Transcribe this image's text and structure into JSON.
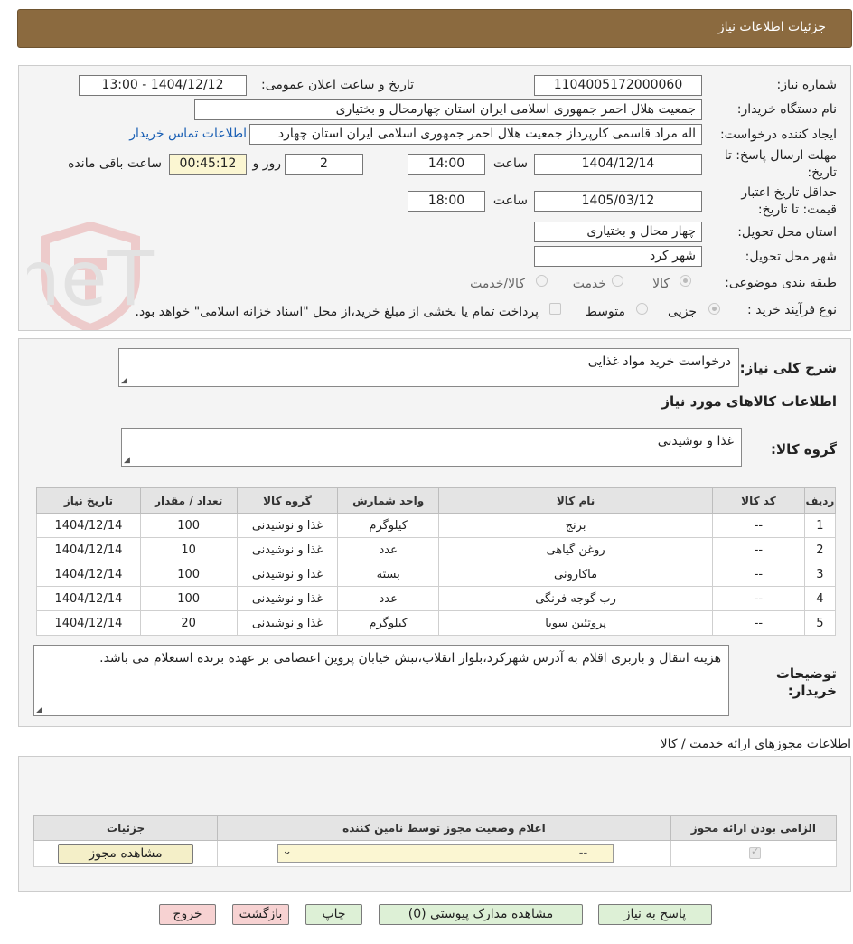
{
  "header": {
    "title": "جزئیات اطلاعات نیاز"
  },
  "watermark": {
    "text": "AriaTender.neT"
  },
  "form": {
    "need_number_label": "شماره نیاز:",
    "need_number": "1104005172000060",
    "announce_label": "تاریخ و ساعت اعلان عمومی:",
    "announce_value": "1404/12/12 - 13:00",
    "buyer_org_label": "نام دستگاه خریدار:",
    "buyer_org": "جمعیت هلال احمر جمهوری اسلامی ایران استان چهارمحال و بختیاری",
    "requester_label": "ایجاد کننده درخواست:",
    "requester": "اله مراد قاسمی کارپرداز جمعیت هلال احمر جمهوری اسلامی ایران استان چهارد",
    "contact_link": "اطلاعات تماس خریدار",
    "deadline_label_1": "مهلت ارسال پاسخ: تا",
    "deadline_label_2": "تاریخ:",
    "deadline_date": "1404/12/14",
    "time_label": "ساعت",
    "deadline_time": "14:00",
    "days_value": "2",
    "days_label": "روز و",
    "remaining_time": "00:45:12",
    "remaining_label": "ساعت باقی مانده",
    "validity_label_1": "حداقل تاریخ اعتبار",
    "validity_label_2": "قیمت: تا تاریخ:",
    "validity_date": "1405/03/12",
    "validity_time_label": "ساعت",
    "validity_time": "18:00",
    "province_label": "استان محل تحویل:",
    "province": "چهار محال و بختیاری",
    "city_label": "شهر محل تحویل:",
    "city": "شهر کرد",
    "category_label": "طبقه بندی موضوعی:",
    "category_options": [
      "کالا",
      "خدمت",
      "کالا/خدمت"
    ],
    "category_selected": "کالا",
    "process_label": "نوع فرآیند خرید :",
    "process_options": [
      "جزیی",
      "متوسط"
    ],
    "process_selected": "جزیی",
    "payment_note": "پرداخت تمام یا بخشی از مبلغ خرید،از محل \"اسناد خزانه اسلامی\" خواهد بود."
  },
  "summary": {
    "general_desc_label": "شرح کلی نیاز:",
    "general_desc": "درخواست خرید مواد غذایی",
    "goods_info_title": "اطلاعات کالاهای مورد نیاز",
    "goods_group_label": "گروه کالا:",
    "goods_group": "غذا و نوشیدنی"
  },
  "goods_table": {
    "headers": [
      "ردیف",
      "کد کالا",
      "نام کالا",
      "واحد شمارش",
      "گروه کالا",
      "تعداد / مقدار",
      "تاریخ نیاز"
    ],
    "rows": [
      [
        "1",
        "--",
        "برنج",
        "کیلوگرم",
        "غذا و نوشیدنی",
        "100",
        "1404/12/14"
      ],
      [
        "2",
        "--",
        "روغن گیاهی",
        "عدد",
        "غذا و نوشیدنی",
        "10",
        "1404/12/14"
      ],
      [
        "3",
        "--",
        "ماکارونی",
        "بسته",
        "غذا و نوشیدنی",
        "100",
        "1404/12/14"
      ],
      [
        "4",
        "--",
        "رب گوجه فرنگی",
        "عدد",
        "غذا و نوشیدنی",
        "100",
        "1404/12/14"
      ],
      [
        "5",
        "--",
        "پروتئین سویا",
        "کیلوگرم",
        "غذا و نوشیدنی",
        "20",
        "1404/12/14"
      ]
    ]
  },
  "buyer_notes": {
    "label_1": "توضیحات",
    "label_2": "خریدار:",
    "text": "هزینه انتقال و باربری اقلام به آدرس شهرکرد،بلوار انقلاب،نبش خیابان پروین اعتصامی بر عهده برنده استعلام می باشد."
  },
  "permits": {
    "title": "اطلاعات مجوزهای ارائه خدمت / کالا",
    "headers": [
      "الزامی بودن ارائه مجوز",
      "اعلام وضعیت مجوز توسط نامین کننده",
      "جزئیات"
    ],
    "select_value": "--",
    "view_button": "مشاهده مجوز"
  },
  "actions": {
    "reply": "پاسخ به نیاز",
    "attachments": "مشاهده مدارک پیوستی (0)",
    "print": "چاپ",
    "back": "بازگشت",
    "exit": "خروج"
  }
}
